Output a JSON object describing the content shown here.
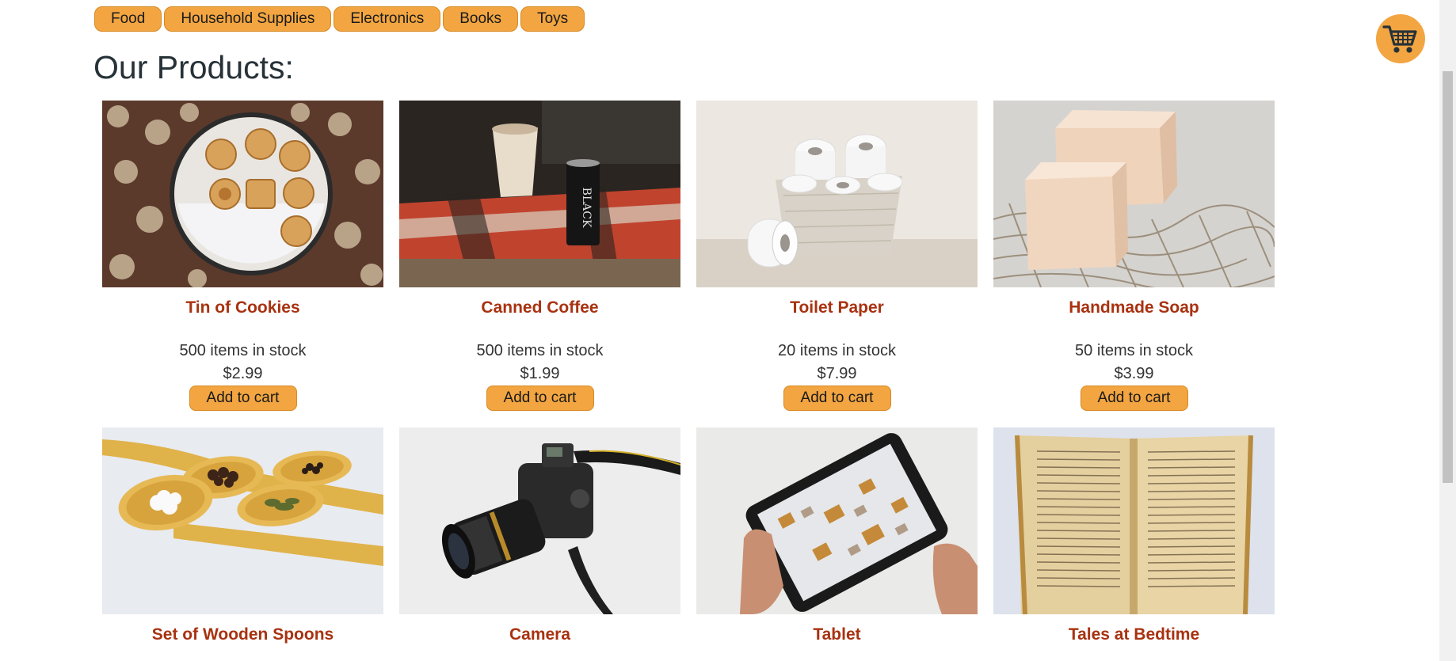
{
  "categories": [
    {
      "label": "Food"
    },
    {
      "label": "Household Supplies"
    },
    {
      "label": "Electronics"
    },
    {
      "label": "Books"
    },
    {
      "label": "Toys"
    }
  ],
  "page_title": "Our Products:",
  "cart": {
    "icon": "shopping-cart-icon",
    "color": "#f2a541"
  },
  "colors": {
    "accent": "#f2a541",
    "product_name": "#a83210"
  },
  "products": [
    {
      "name": "Tin of Cookies",
      "stock": "500 items in stock",
      "price": "$2.99",
      "button": "Add to cart",
      "image": "cookie-tin-photo"
    },
    {
      "name": "Canned Coffee",
      "stock": "500 items in stock",
      "price": "$1.99",
      "button": "Add to cart",
      "image": "canned-coffee-photo"
    },
    {
      "name": "Toilet Paper",
      "stock": "20 items in stock",
      "price": "$7.99",
      "button": "Add to cart",
      "image": "toilet-paper-photo"
    },
    {
      "name": "Handmade Soap",
      "stock": "50 items in stock",
      "price": "$3.99",
      "button": "Add to cart",
      "image": "soap-photo"
    },
    {
      "name": "Set of Wooden Spoons",
      "image": "wooden-spoons-photo"
    },
    {
      "name": "Camera",
      "image": "camera-photo"
    },
    {
      "name": "Tablet",
      "image": "tablet-photo"
    },
    {
      "name": "Tales at Bedtime",
      "image": "open-book-photo"
    }
  ]
}
